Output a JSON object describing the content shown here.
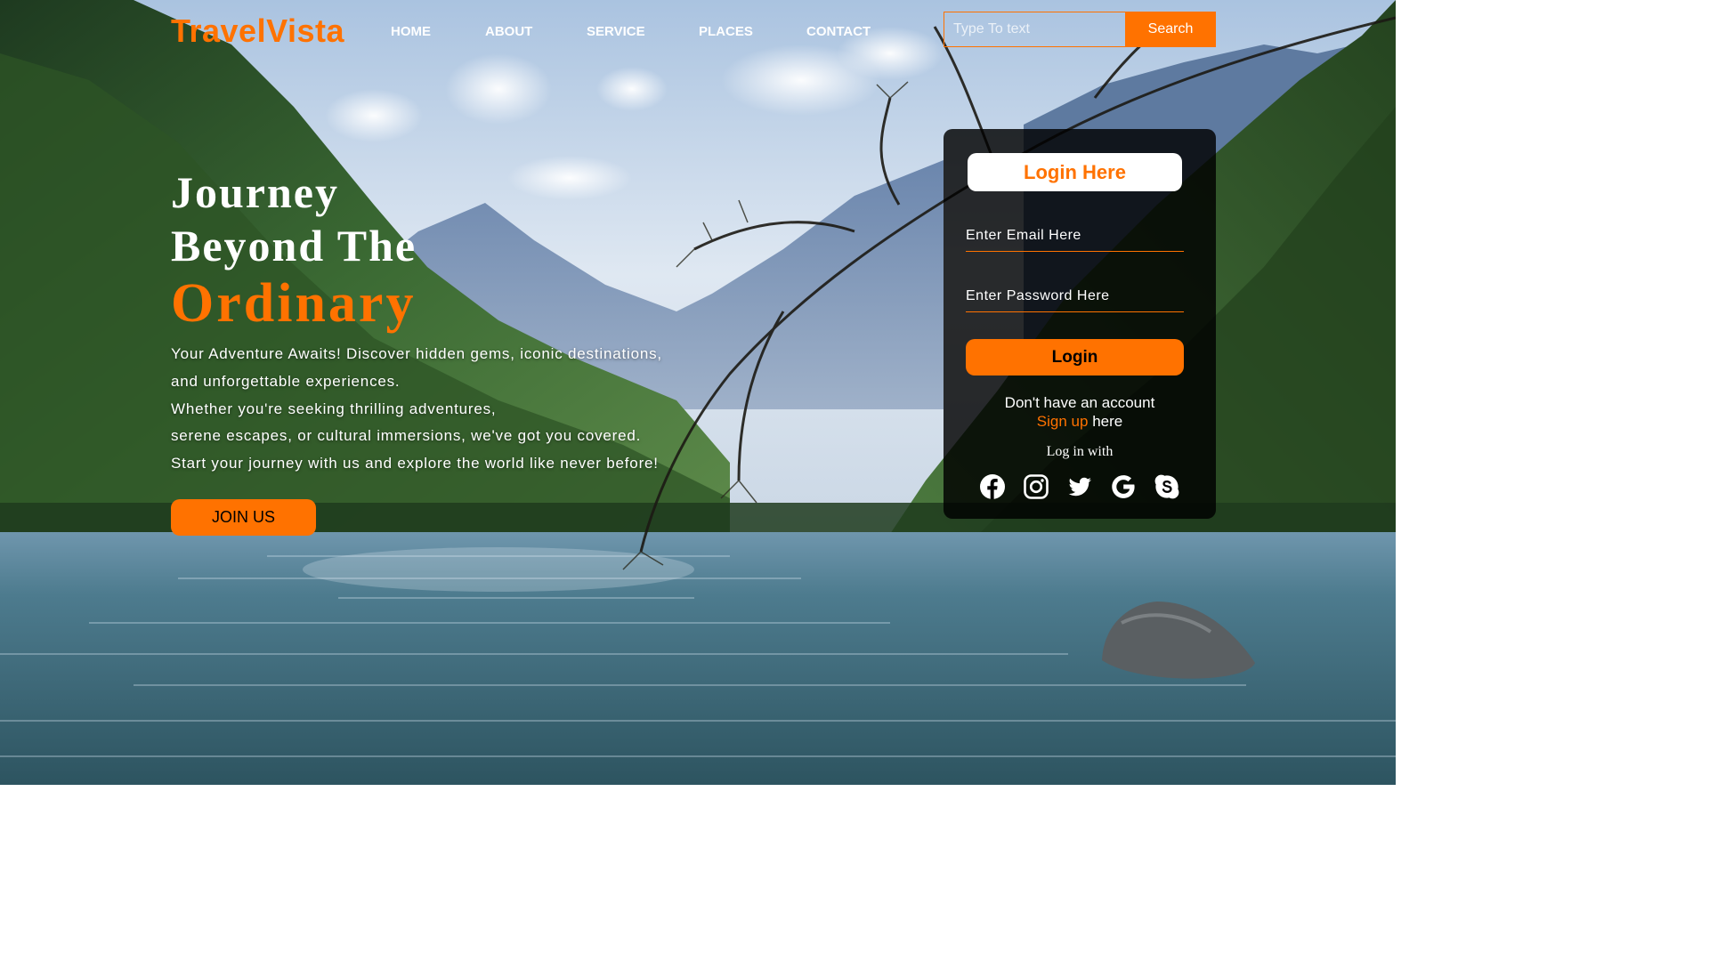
{
  "brand": {
    "name": "TravelVista"
  },
  "nav": {
    "items": [
      "HOME",
      "ABOUT",
      "SERVICE",
      "PLACES",
      "CONTACT"
    ]
  },
  "search": {
    "placeholder": "Type To text",
    "button_label": "Search"
  },
  "hero": {
    "title_line1": "Journey",
    "title_line2": "Beyond The",
    "title_accent": "Ordinary",
    "paragraph_lines": [
      "Your Adventure Awaits! Discover hidden gems, iconic destinations,",
      "and unforgettable experiences.",
      "Whether you're seeking thrilling adventures,",
      "serene escapes, or cultural immersions, we've got you covered.",
      "Start your journey with us and explore the world like never before!"
    ],
    "cta_label": "JOIN US"
  },
  "login": {
    "heading": "Login Here",
    "email_placeholder": "Enter Email Here",
    "password_placeholder": "Enter Password Here",
    "button_label": "Login",
    "no_account_text": "Don't have an account",
    "signup_link": "Sign up",
    "signup_suffix": "here",
    "login_with": "Log in with",
    "socials": [
      "facebook-icon",
      "instagram-icon",
      "twitter-icon",
      "google-icon",
      "skype-icon"
    ]
  },
  "colors": {
    "accent": "#ff7200",
    "card_bg": "#000000",
    "text": "#ffffff"
  }
}
